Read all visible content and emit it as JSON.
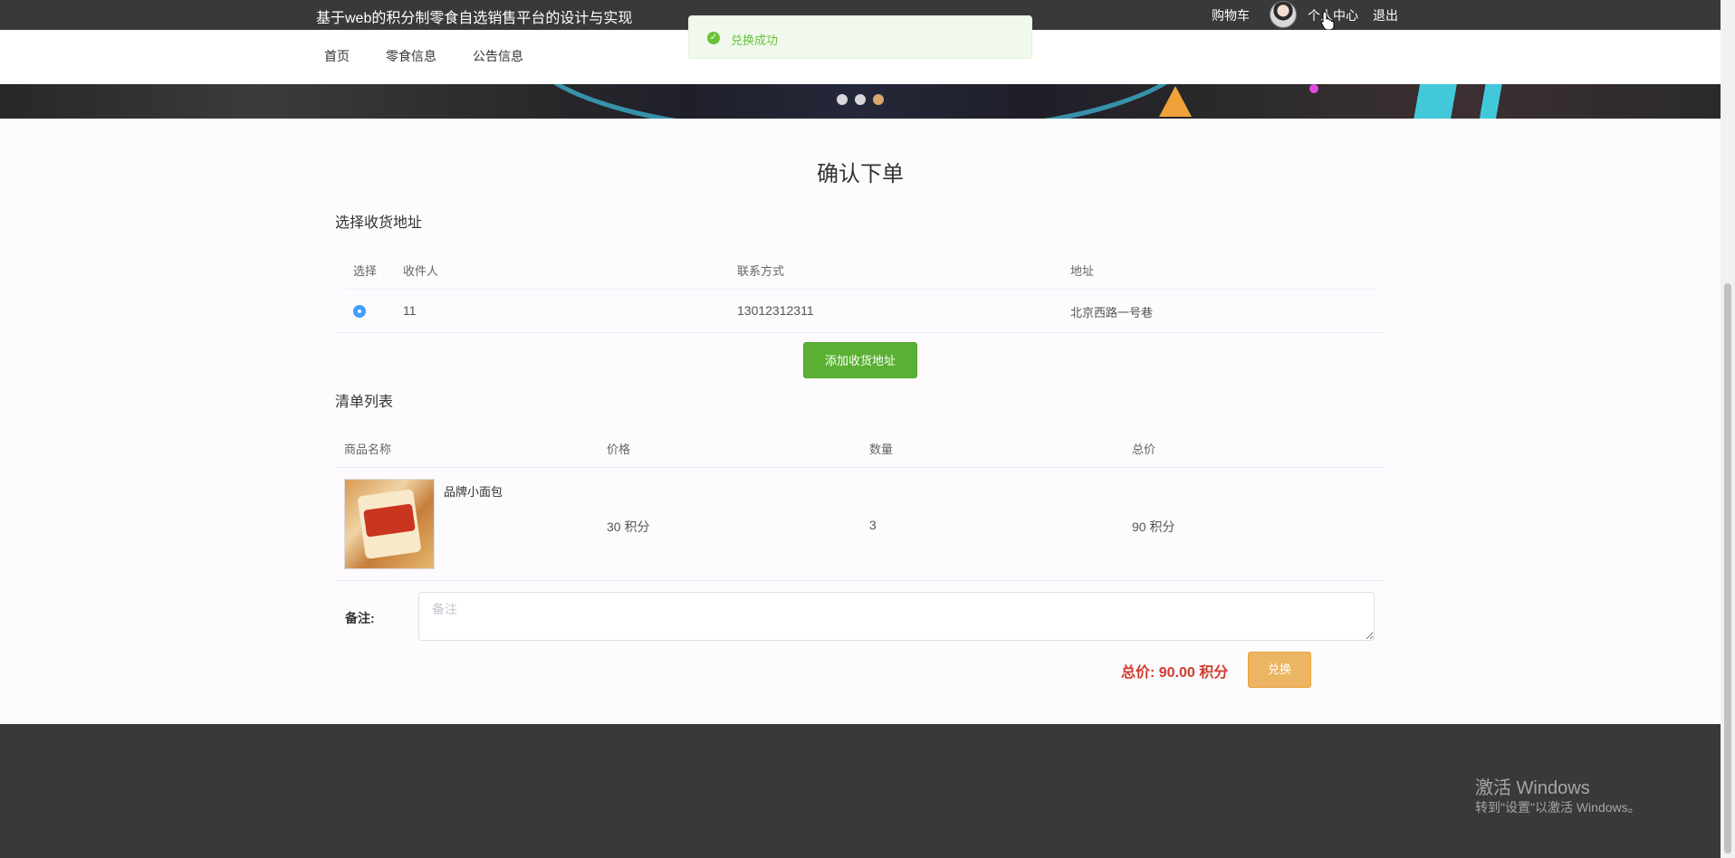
{
  "topbar": {
    "site_title": "基于web的积分制零食自选销售平台的设计与实现",
    "cart": "购物车",
    "personal_center": "个人中心",
    "logout": "退出"
  },
  "nav": {
    "items": [
      "首页",
      "零食信息",
      "公告信息"
    ]
  },
  "toast": {
    "message": "兑换成功",
    "color": "#67c23a"
  },
  "page": {
    "title": "确认下单"
  },
  "address_section": {
    "title": "选择收货地址",
    "headers": [
      "选择",
      "收件人",
      "联系方式",
      "地址"
    ],
    "rows": [
      {
        "selected": true,
        "recipient": "11",
        "phone": "13012312311",
        "address": "北京西路一号巷"
      }
    ],
    "add_button": "添加收货地址"
  },
  "order_section": {
    "title": "清单列表",
    "headers": [
      "商品名称",
      "价格",
      "数量",
      "总价"
    ],
    "items": [
      {
        "name": "品牌小面包",
        "price": "30 积分",
        "quantity": "3",
        "subtotal": "90 积分"
      }
    ]
  },
  "remark": {
    "label": "备注:",
    "placeholder": "备注"
  },
  "summary": {
    "total": "总价: 90.00 积分",
    "exchange_button": "兑换"
  },
  "watermark": {
    "line1": "激活 Windows",
    "line2": "转到\"设置\"以激活 Windows。"
  },
  "colors": {
    "topbar": "#393939",
    "add_button": "#5ab032",
    "exchange_button": "#ebb563",
    "total_text": "#d23a2c",
    "radio": "#409eff"
  }
}
